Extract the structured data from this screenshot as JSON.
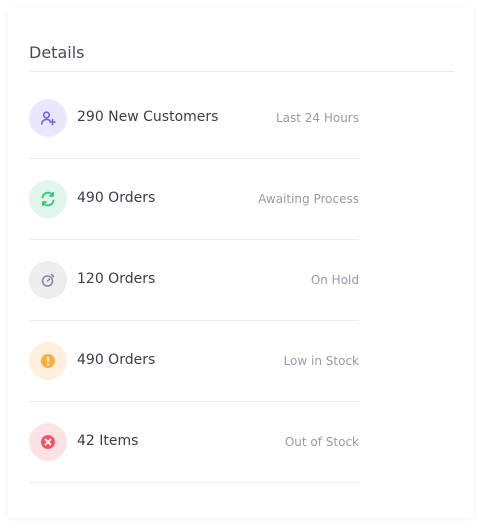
{
  "details": {
    "title": "Details",
    "items": [
      {
        "icon": "user-plus-icon",
        "label": "290 New Customers",
        "meta": "Last 24 Hours",
        "bg": "#e9e7fd",
        "fg": "#6f63e8"
      },
      {
        "icon": "refresh-icon",
        "label": "490 Orders",
        "meta": "Awaiting Process",
        "bg": "#e0f6ea",
        "fg": "#2fc27a"
      },
      {
        "icon": "timer-icon",
        "label": "120 Orders",
        "meta": "On Hold",
        "bg": "#ececf1",
        "fg": "#8a8a99"
      },
      {
        "icon": "alert-circle-icon",
        "label": "490 Orders",
        "meta": "Low in Stock",
        "bg": "#fdf1de",
        "fg": "#f5b041"
      },
      {
        "icon": "x-circle-icon",
        "label": "42 Items",
        "meta": "Out of Stock",
        "bg": "#fde2e5",
        "fg": "#f25767"
      }
    ]
  }
}
